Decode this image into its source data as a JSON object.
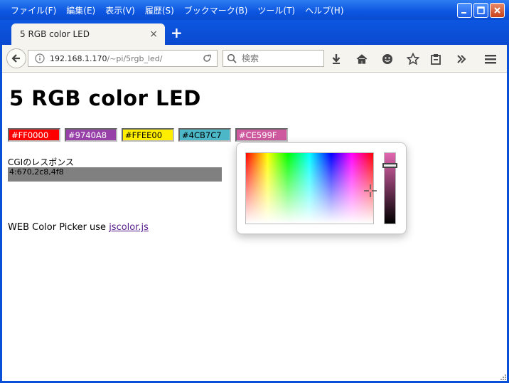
{
  "menu": [
    "ファイル(F)",
    "編集(E)",
    "表示(V)",
    "履歴(S)",
    "ブックマーク(B)",
    "ツール(T)",
    "ヘルプ(H)"
  ],
  "tab": {
    "title": "5 RGB color LED",
    "close": "×",
    "new_tab": "+"
  },
  "nav": {
    "url_host": "192.168.1.170",
    "url_path": "/~pi/5rgb_led/",
    "search_placeholder": "検索"
  },
  "page": {
    "heading": "5 RGB color LED",
    "swatches": [
      {
        "value": "#FF0000",
        "bg": "#FF0000",
        "fg": "#FFFFFF"
      },
      {
        "value": "#9740A8",
        "bg": "#9740A8",
        "fg": "#FFFFFF"
      },
      {
        "value": "#FFEE00",
        "bg": "#FFEE00",
        "fg": "#000000"
      },
      {
        "value": "#4CB7C7",
        "bg": "#4CB7C7",
        "fg": "#000000"
      },
      {
        "value": "#CE599F",
        "bg": "#CE599F",
        "fg": "#FFFFFF"
      }
    ],
    "cgi_label": "CGIのレスポンス",
    "cgi_response": "4:670,2c8,4f8",
    "footer_text": "WEB Color Picker use ",
    "footer_link": "jscolor.js"
  },
  "icons": [
    "back-icon",
    "info-icon",
    "reload-icon",
    "search-icon",
    "download-icon",
    "home-icon",
    "smiley-icon",
    "star-icon",
    "clipboard-icon",
    "overflow-icon",
    "menu-icon",
    "crosshair-icon"
  ]
}
